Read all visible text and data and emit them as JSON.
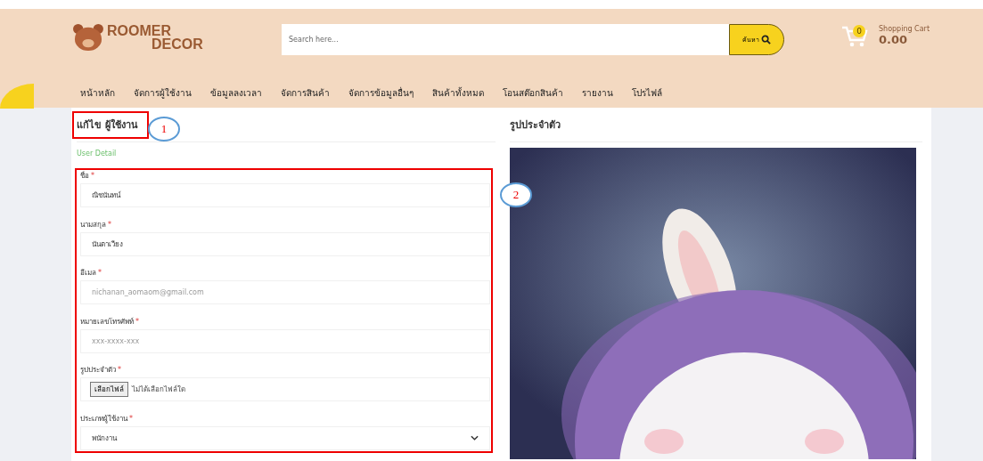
{
  "logo": {
    "line_1": "ROOMER",
    "line_2": "DECOR"
  },
  "search": {
    "placeholder": "Search here...",
    "button": "ค้นหา"
  },
  "cart": {
    "count": "0",
    "label": "Shopping Cart",
    "total": "0.00"
  },
  "nav": [
    "หน้าหลัก",
    "จัดการผู้ใช้งาน",
    "ข้อมูลลงเวลา",
    "จัดการสินค้า",
    "จัดการข้อมูลอื่นๆ",
    "สินค้าทั้งหมด",
    "โอนสต๊อกสินค้า",
    "รายงาน",
    "โปรไฟล์"
  ],
  "form": {
    "title": "แก้ไข ผู้ใช้งาน",
    "subtitle": "User Detail",
    "required_mark": "*",
    "fields": [
      {
        "kind": "text",
        "label": "ชื่อ",
        "required": true,
        "value": "ณิชนันทน์"
      },
      {
        "kind": "text",
        "label": "นามสกุล",
        "required": true,
        "value": "นันตาเวียง"
      },
      {
        "kind": "text",
        "label": "อีเมล",
        "required": true,
        "placeholder": "nichanan_aomaom@gmail.com"
      },
      {
        "kind": "text",
        "label": "หมายเลขโทรศัพท์",
        "required": true,
        "placeholder": "xxx-xxxx-xxx"
      },
      {
        "kind": "file",
        "label": "รูปประจำตัว",
        "required": true,
        "button": "เลือกไฟล์",
        "status": "ไม่ได้เลือกไฟล์ใด"
      },
      {
        "kind": "select",
        "label": "ประเภทผู้ใช้งาน",
        "required": true,
        "value": "พนักงาน"
      }
    ]
  },
  "photo_panel": {
    "title": "รูปประจำตัว",
    "kind": "picture"
  },
  "annotations": [
    "1",
    "2"
  ]
}
